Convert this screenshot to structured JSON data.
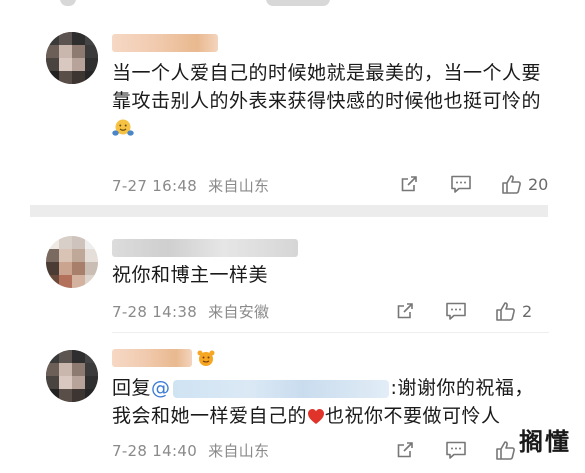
{
  "comments": [
    {
      "text": "当一个人爱自己的时候她就是最美的，当一个人要靠攻击别人的外表来获得快感的时候他也挺可怜的",
      "emoji_icon": "hugging-face-emoji",
      "time": "7-27 16:48",
      "location": "来自山东",
      "likes": "20"
    },
    {
      "text": "祝你和博主一样美",
      "time": "7-28 14:38",
      "location": "来自安徽",
      "likes": "2"
    },
    {
      "reply_prefix": "回复",
      "at_sign": "@",
      "mention_suffix": ":谢谢你的祝福，",
      "line2_a": "我会和她一样爱自己的",
      "line2_b": "也祝你不要做可怜人",
      "heart_icon": "red-heart-icon",
      "time": "7-28 14:40",
      "location": "来自山东"
    }
  ],
  "watermark": "搁懂",
  "colors": {
    "meta_gray": "#8a8a8a",
    "mention_blue": "#3a7bd5",
    "heart_red": "#e0342b",
    "divider": "#ececec"
  }
}
